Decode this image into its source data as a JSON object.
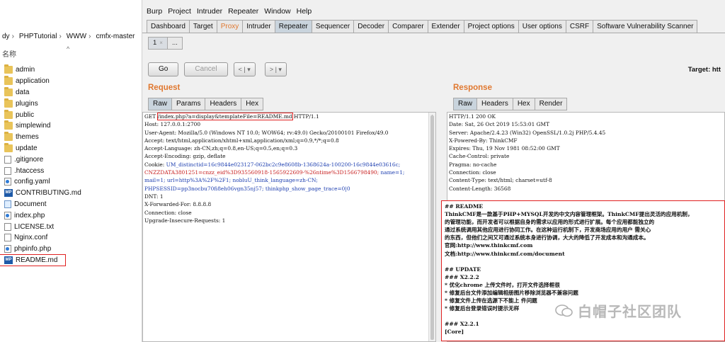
{
  "explorer": {
    "breadcrumb": [
      "dy",
      "PHPTutorial",
      "WWW",
      "cmfx-master"
    ],
    "column_name": "名称",
    "files": [
      {
        "name": "admin",
        "icon": "folder-icon"
      },
      {
        "name": "application",
        "icon": "folder-icon"
      },
      {
        "name": "data",
        "icon": "folder-icon"
      },
      {
        "name": "plugins",
        "icon": "folder-icon"
      },
      {
        "name": "public",
        "icon": "folder-icon"
      },
      {
        "name": "simplewind",
        "icon": "folder-icon"
      },
      {
        "name": "themes",
        "icon": "folder-icon"
      },
      {
        "name": "update",
        "icon": "folder-icon"
      },
      {
        "name": ".gitignore",
        "icon": "file-icon"
      },
      {
        "name": ".htaccess",
        "icon": "file-icon"
      },
      {
        "name": "config.yaml",
        "icon": "file-icon"
      },
      {
        "name": "CONTRIBUTING.md",
        "icon": "markdown-icon"
      },
      {
        "name": "Document",
        "icon": "shortcut-icon"
      },
      {
        "name": "index.php",
        "icon": "file-icon"
      },
      {
        "name": "LICENSE.txt",
        "icon": "file-icon"
      },
      {
        "name": "Nginx.conf",
        "icon": "file-icon"
      },
      {
        "name": "phpinfo.php",
        "icon": "file-icon"
      },
      {
        "name": "README.md",
        "icon": "markdown-icon"
      }
    ]
  },
  "burp": {
    "menu": [
      "Burp",
      "Project",
      "Intruder",
      "Repeater",
      "Window",
      "Help"
    ],
    "tabs": [
      "Dashboard",
      "Target",
      "Proxy",
      "Intruder",
      "Repeater",
      "Sequencer",
      "Decoder",
      "Comparer",
      "Extender",
      "Project options",
      "User options",
      "CSRF",
      "Software Vulnerability Scanner"
    ],
    "active_tab": "Repeater",
    "sub_tabs": [
      "1",
      "..."
    ],
    "sub_tab_close": "×",
    "go_label": "Go",
    "cancel_label": "Cancel",
    "back_label": "<",
    "forward_label": ">",
    "dropdown_label": "▾",
    "target_label": "Target: htt",
    "request": {
      "title": "Request",
      "tabs": [
        "Raw",
        "Params",
        "Headers",
        "Hex"
      ],
      "lines": [
        "Host: 127.0.0.1:2700",
        "User-Agent: Mozilla/5.0 (Windows NT 10.0; WOW64; rv:49.0) Gecko/20100101 Firefox/49.0",
        "Accept: text/html,application/xhtml+xml,application/xml;q=0.9,*/*;q=0.8",
        "Accept-Language: zh-CN,zh;q=0.8,en-US;q=0.5,en;q=0.3",
        "Accept-Encoding: gzip, deflate",
        "DNT: 1",
        "X-Forwarded-For: 8.8.8.8",
        "Connection: close",
        "Upgrade-Insecure-Requests: 1"
      ],
      "method": "GET",
      "url": "/index.php?a=display&templateFile=README.md",
      "protocol": "HTTP/1.1",
      "cookie_label": "Cookie:",
      "cookie_1": "UM_distinctid=16c9844e023127-062bc2c9e8608b-1368624a-100200-16c9844e03616c;",
      "cookie_2": "CNZZDATA3801251=cnzz_eid%3D935560918-1565922609-%26ntime%3D1566798490;",
      "cookie_2b": "name=1;",
      "cookie_3": "mail=1; url=http%3A%2F%2F1; nobluU_think_language=zh-CN;",
      "cookie_4": "PHPSESSID=pp3nocbu70fi8eh06vgn35nj57;",
      "cookie_4b": "thinkphp_show_page_trace=0|0"
    },
    "response": {
      "title": "Response",
      "tabs": [
        "Raw",
        "Headers",
        "Hex",
        "Render"
      ],
      "lines": [
        "HTTP/1.1 200 OK",
        "Date: Sat, 26 Oct 2019 15:53:01 GMT",
        "Server: Apache/2.4.23 (Win32) OpenSSL/1.0.2j PHP/5.4.45",
        "X-Powered-By: ThinkCMF",
        "Expires: Thu, 19 Nov 1981 08:52:00 GMT",
        "Cache-Control: private",
        "Pragma: no-cache",
        "Connection: close",
        "Content-Type: text/html; charset=utf-8",
        "Content-Length: 36568"
      ],
      "readme": [
        "## README",
        "ThinkCMF是一款基于PHP+MYSQL开发的中文内容管理框架。ThinkCMF提出灵活的应用机制，",
        "   的管理功能，而开发者可以根据自身的需求以应用的形式进行扩展。每个应用都能独立的",
        "通过系统调用其他应用进行协同工作。在这种运行机制下，开发商场应用的用户      需关心",
        "的东西，但他们之间又可通过系统本身进行协调，大大的降低了开发成本和沟通成本。",
        "官网:http://www.thinkcmf.com",
        "文档:http://www.thinkcmf.com/document",
        "",
        "## UPDATE",
        "### X2.2.2",
        "* 优化chrome 上传文件时，打开文件选择框很",
        "* 修复后台文件添加编辑相册图片移除浏览器不兼容问题",
        "* 修复文件上传在选源下不能上   件问题",
        "* 修复后台登录错误时提示无样",
        "",
        "### X2.2.1",
        "[Core]"
      ]
    },
    "watermark": "白帽子社区团队"
  }
}
